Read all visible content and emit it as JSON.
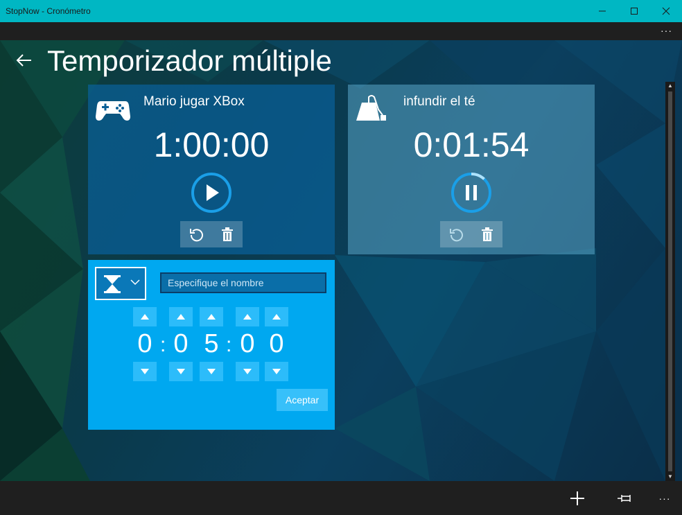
{
  "window": {
    "title": "StopNow - Cronómetro",
    "more_label": "···"
  },
  "page": {
    "title": "Temporizador múltiple"
  },
  "timers": [
    {
      "name": "Mario jugar XBox",
      "time": "1:00:00",
      "icon": "gamepad-icon",
      "state": "stopped"
    },
    {
      "name": "infundir el té",
      "time": "0:01:54",
      "icon": "teabag-icon",
      "state": "running",
      "progress": 0.12
    }
  ],
  "new_timer": {
    "icon": "hourglass-icon",
    "name_placeholder": "Especifique el nombre",
    "digits": [
      "0",
      "0",
      "5",
      "0",
      "0"
    ],
    "separator": ":",
    "accept_label": "Aceptar"
  },
  "appbar": {
    "more_label": "···"
  },
  "colors": {
    "titlebar": "#00b7c3",
    "accent": "#00a8f0",
    "ring": "#1a9fe8"
  }
}
